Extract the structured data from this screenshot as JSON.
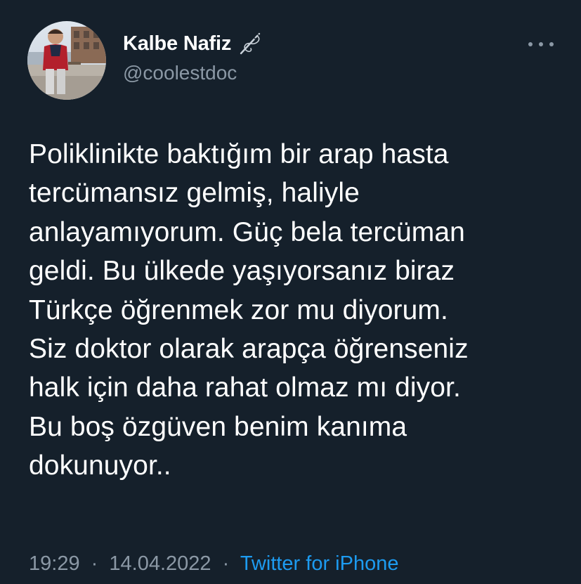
{
  "author": {
    "display_name": "Kalbe Nafiz",
    "handle": "@coolestdoc",
    "name_badge_icon": "needle-thread-icon",
    "avatar_icon": "profile-photo"
  },
  "actions": {
    "more_icon": "more-horizontal-icon"
  },
  "tweet": {
    "text": "Poliklinikte baktığım bir arap hasta\ntercümansız gelmiş, haliyle\nanlayamıyorum. Güç bela tercüman\ngeldi. Bu ülkede yaşıyorsanız biraz\nTürkçe öğrenmek zor mu diyorum.\nSiz doktor olarak arapça öğrenseniz\nhalk için daha rahat olmaz mı diyor.\nBu boş özgüven benim kanıma\ndokunuyor..",
    "time": "19:29",
    "separator": "·",
    "date": "14.04.2022",
    "source": "Twitter for iPhone"
  },
  "colors": {
    "background": "#15202b",
    "text": "#ffffff",
    "secondary_text": "#8b98a5",
    "link": "#1d9bf0"
  }
}
